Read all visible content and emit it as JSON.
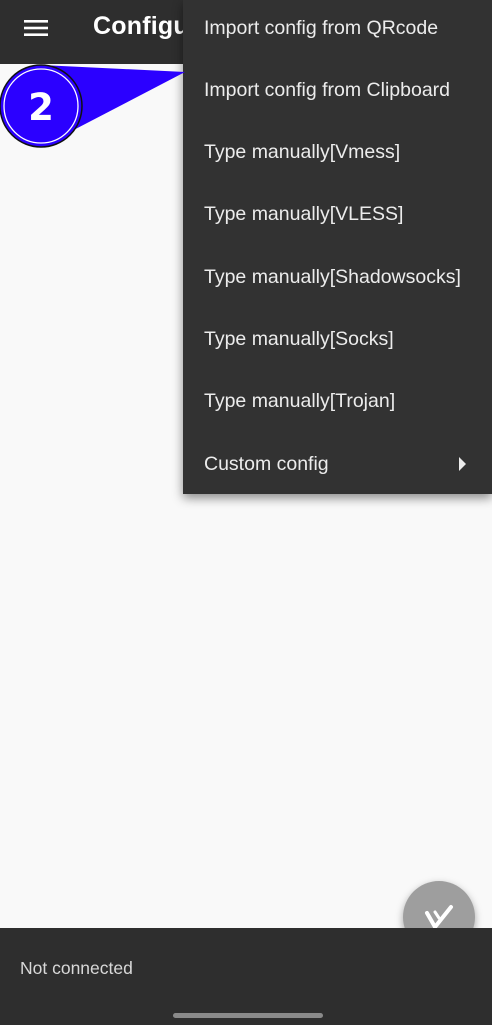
{
  "appbar": {
    "menu_icon": "hamburger-menu-icon",
    "title": "Configu"
  },
  "dropdown": {
    "items": [
      {
        "label": "Import config from QRcode"
      },
      {
        "label": "Import config from Clipboard"
      },
      {
        "label": "Type manually[Vmess]"
      },
      {
        "label": "Type manually[VLESS]"
      },
      {
        "label": "Type manually[Shadowsocks]"
      },
      {
        "label": "Type manually[Socks]"
      },
      {
        "label": "Type manually[Trojan]"
      },
      {
        "label": "Custom config",
        "submenu_icon": "chevron-right-icon"
      }
    ]
  },
  "annotation": {
    "step_number": "2",
    "color": "#2b00ff"
  },
  "fab": {
    "icon": "v-logo-icon"
  },
  "bottombar": {
    "status": "Not connected"
  },
  "colors": {
    "appbar_bg": "#2e2e2e",
    "menu_bg": "#323232",
    "content_bg": "#f9f9f9",
    "fab_bg": "#9e9e9e"
  }
}
